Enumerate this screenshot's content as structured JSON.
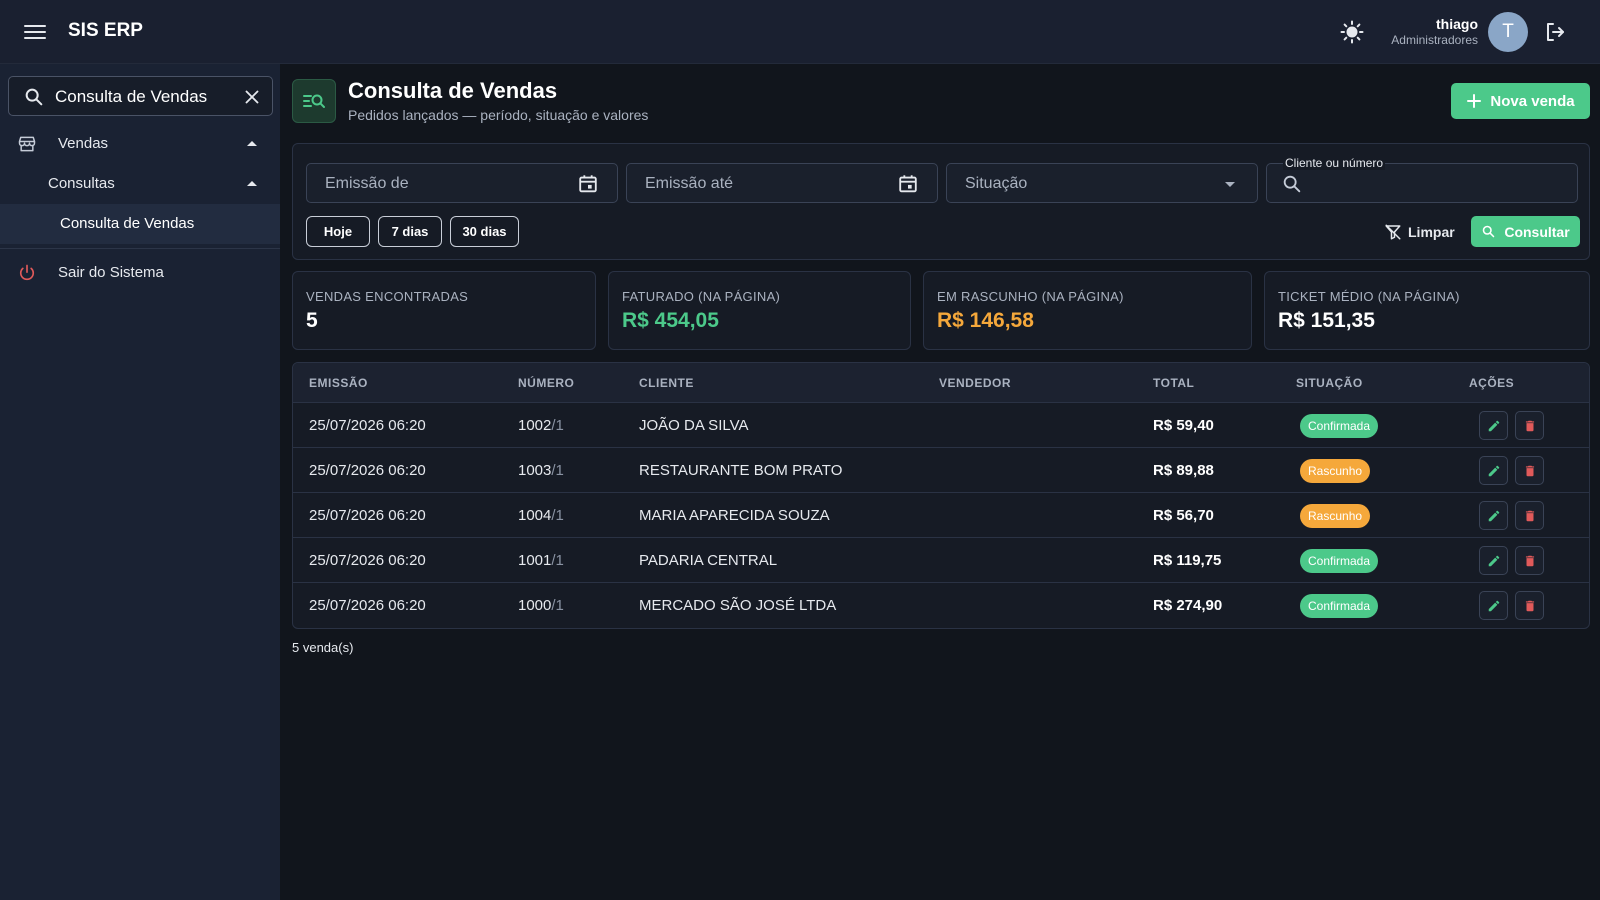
{
  "header": {
    "app_title": "SIS ERP",
    "user_name": "thiago",
    "user_role": "Administradores",
    "avatar_initial": "T",
    "icons": [
      "menu-icon",
      "sun-icon",
      "logout-icon"
    ]
  },
  "sidebar": {
    "search_value": "Consulta de Vendas",
    "items": [
      {
        "label": "Vendas",
        "icon": "store-icon",
        "expanded": true
      },
      {
        "label": "Consultas",
        "expanded": true
      },
      {
        "label": "Consulta de Vendas",
        "active": true
      },
      {
        "label": "Sair do Sistema",
        "icon": "power-icon"
      }
    ]
  },
  "page": {
    "title": "Consulta de Vendas",
    "subtitle": "Pedidos lançados — período, situação e valores",
    "new_button": "Nova venda"
  },
  "filters": {
    "emissao_de": "Emissão de",
    "emissao_ate": "Emissão até",
    "situacao": "Situação",
    "cliente_label": "Cliente ou número",
    "cliente_value": "",
    "chips": [
      "Hoje",
      "7 dias",
      "30 dias"
    ],
    "limpar": "Limpar",
    "consultar": "Consultar"
  },
  "stats": [
    {
      "label": "VENDAS ENCONTRADAS",
      "value": "5",
      "color": "#ffffff"
    },
    {
      "label": "FATURADO (NA PÁGINA)",
      "value": "R$ 454,05",
      "color": "#4cc98a"
    },
    {
      "label": "EM RASCUNHO (NA PÁGINA)",
      "value": "R$ 146,58",
      "color": "#f5a83b"
    },
    {
      "label": "TICKET MÉDIO (NA PÁGINA)",
      "value": "R$ 151,35",
      "color": "#ffffff"
    }
  ],
  "table": {
    "columns": [
      "EMISSÃO",
      "NÚMERO",
      "CLIENTE",
      "VENDEDOR",
      "TOTAL",
      "SITUAÇÃO",
      "AÇÕES"
    ],
    "rows": [
      {
        "emissao": "25/07/2026 06:20",
        "numero": "1002",
        "serie": "/1",
        "cliente": "JOÃO DA SILVA",
        "vendedor": "",
        "total": "R$ 59,40",
        "situacao": "Confirmada"
      },
      {
        "emissao": "25/07/2026 06:20",
        "numero": "1003",
        "serie": "/1",
        "cliente": "RESTAURANTE BOM PRATO",
        "vendedor": "",
        "total": "R$ 89,88",
        "situacao": "Rascunho"
      },
      {
        "emissao": "25/07/2026 06:20",
        "numero": "1004",
        "serie": "/1",
        "cliente": "MARIA APARECIDA SOUZA",
        "vendedor": "",
        "total": "R$ 56,70",
        "situacao": "Rascunho"
      },
      {
        "emissao": "25/07/2026 06:20",
        "numero": "1001",
        "serie": "/1",
        "cliente": "PADARIA CENTRAL",
        "vendedor": "",
        "total": "R$ 119,75",
        "situacao": "Confirmada"
      },
      {
        "emissao": "25/07/2026 06:20",
        "numero": "1000",
        "serie": "/1",
        "cliente": "MERCADO SÃO JOSÉ LTDA",
        "vendedor": "",
        "total": "R$ 274,90",
        "situacao": "Confirmada"
      }
    ]
  },
  "footer": {
    "count": "5 venda(s)"
  },
  "colors": {
    "accent": "#4cc98a",
    "draft": "#f5a83b",
    "danger": "#e05a5a",
    "background": "#11151c",
    "sidebar": "#1a2233"
  }
}
